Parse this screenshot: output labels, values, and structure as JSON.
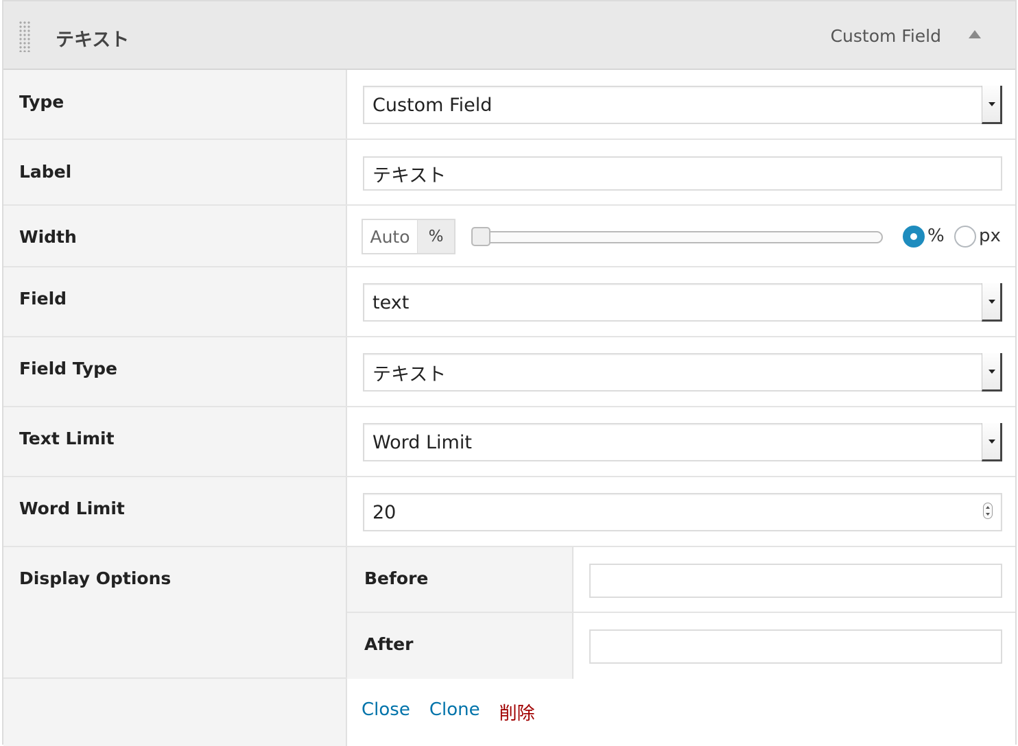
{
  "header": {
    "title": "テキスト",
    "type_label": "Custom Field"
  },
  "rows": {
    "type": {
      "label": "Type",
      "value": "Custom Field"
    },
    "label": {
      "label": "Label",
      "value": "テキスト"
    },
    "width": {
      "label": "Width",
      "auto_text": "Auto",
      "percent_text": "%",
      "slider_value": 0,
      "unit_options": [
        "%",
        "px"
      ],
      "selected_unit": "%"
    },
    "field": {
      "label": "Field",
      "value": "text"
    },
    "field_type": {
      "label": "Field Type",
      "value": "テキスト"
    },
    "text_limit": {
      "label": "Text Limit",
      "value": "Word Limit"
    },
    "word_limit": {
      "label": "Word Limit",
      "value": "20"
    },
    "display_options": {
      "label": "Display Options",
      "before": {
        "label": "Before",
        "value": ""
      },
      "after": {
        "label": "After",
        "value": ""
      }
    }
  },
  "actions": {
    "close": "Close",
    "clone": "Clone",
    "delete": "削除"
  },
  "colors": {
    "link": "#0073aa",
    "delete": "#a00000",
    "radio_active": "#1e8cbe"
  },
  "icons": {
    "drag": "drag-handle-icon",
    "collapse": "triangle-up-icon",
    "select_arrow": "chevron-down-icon",
    "spinner": "number-spinner-icon"
  }
}
